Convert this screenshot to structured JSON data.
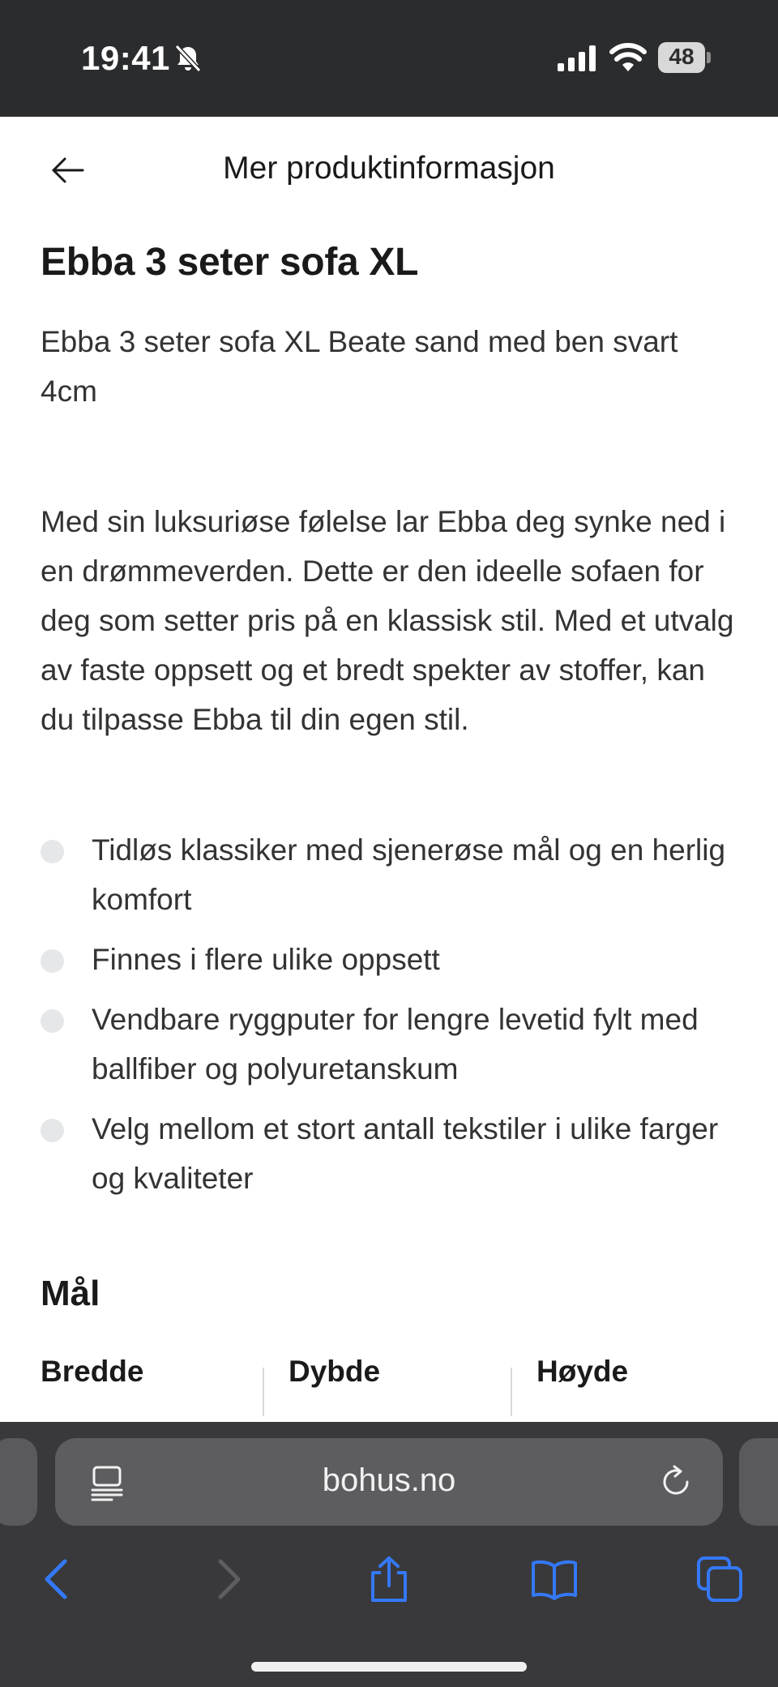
{
  "status_bar": {
    "time": "19:41",
    "battery": "48"
  },
  "header": {
    "title": "Mer produktinformasjon"
  },
  "product": {
    "title": "Ebba 3 seter sofa XL",
    "subtitle": "Ebba 3 seter sofa XL Beate sand med ben svart 4cm",
    "description": "Med sin luksuriøse følelse lar Ebba deg synke ned i en drømmeverden. Dette er den ideelle sofaen for deg som setter pris på en klassisk stil. Med et utvalg av faste oppsett og et bredt spekter av stoffer, kan du tilpasse Ebba til din egen stil.",
    "features": [
      "Tidløs klassiker med sjenerøse mål og en herlig komfort",
      "Finnes i flere ulike oppsett",
      "Vendbare ryggputer for lengre levetid fylt med ballfiber og polyuretanskum",
      "Velg mellom et stort antall tekstiler i ulike farger og kvaliteter"
    ]
  },
  "dimensions": {
    "heading": "Mål",
    "columns": [
      "Bredde",
      "Dybde",
      "Høyde"
    ]
  },
  "browser": {
    "url": "bohus.no"
  },
  "icons": {
    "back": "arrow-left-icon",
    "reader": "reader-mode-icon",
    "reload": "reload-icon",
    "nav_back": "chevron-left-icon",
    "nav_forward": "chevron-right-icon",
    "share": "share-icon",
    "bookmarks": "book-icon",
    "tabs": "tabs-icon"
  },
  "colors": {
    "accent": "#3478f6",
    "status_bar_bg": "#2b2c2e",
    "browser_bar_bg": "#39393b",
    "bullet": "#e6e7e8"
  }
}
